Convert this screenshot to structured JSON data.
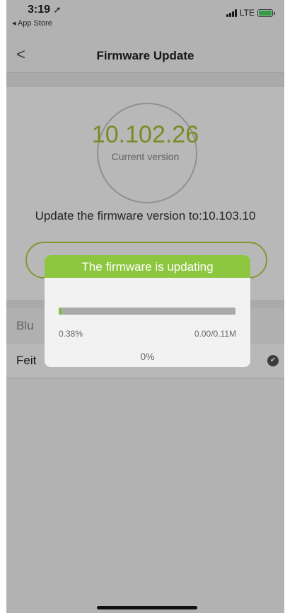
{
  "status_bar": {
    "time": "3:19",
    "location_arrow": "➚",
    "back_app": "◂ App Store",
    "network": "LTE"
  },
  "nav": {
    "back_glyph": "<",
    "title": "Firmware Update"
  },
  "firmware": {
    "current_version": "10.102.26",
    "current_version_label": "Current version",
    "update_text": "Update the firmware version to:10.103.10"
  },
  "list": {
    "header_label": "Blu",
    "device_name": "Feit",
    "check_glyph": "✔"
  },
  "dialog": {
    "title": "The firmware is updating",
    "progress_fraction": 0.0038,
    "percent_left": "0.38%",
    "size_right": "0.00/0.11M",
    "percent_center": "0%"
  },
  "colors": {
    "accent_green": "#8dc63f",
    "version_green": "#a6c334",
    "progress_green": "#7cc142"
  },
  "icons": {
    "back": "chevron-left-icon",
    "check": "check-circle-icon",
    "signal": "cellular-signal-icon",
    "battery": "battery-charging-icon"
  }
}
